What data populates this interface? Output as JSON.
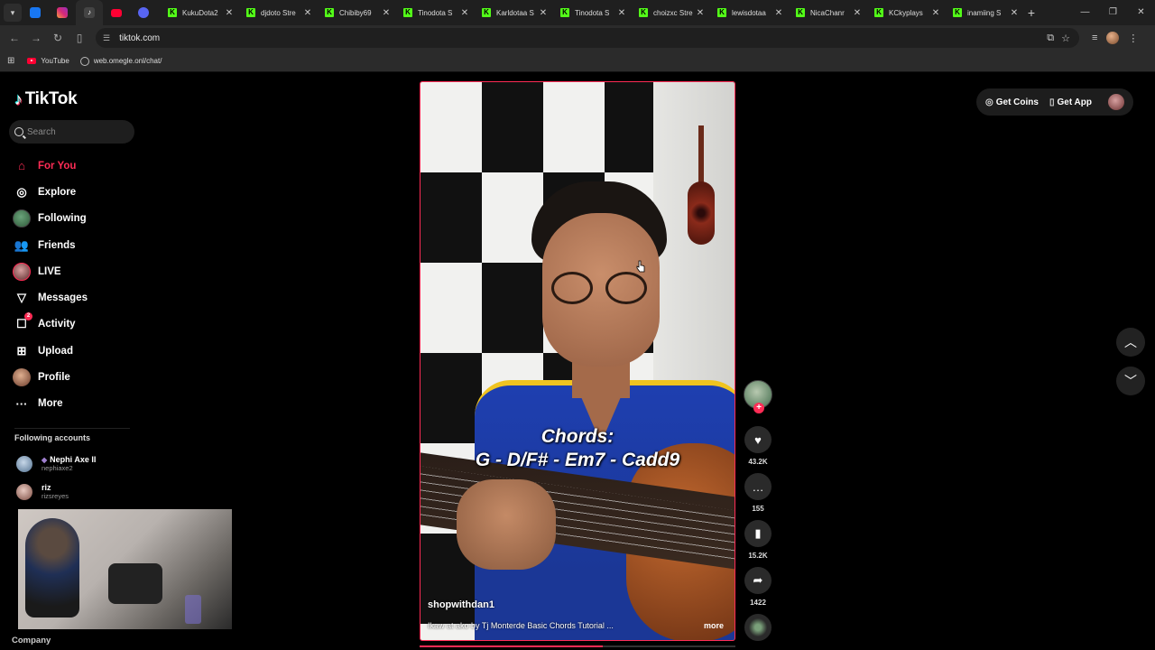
{
  "browser": {
    "tabs": [
      {
        "label": "KukuDota2"
      },
      {
        "label": "djdoto Stre"
      },
      {
        "label": "Chibiby69"
      },
      {
        "label": "Tinodota S"
      },
      {
        "label": "Karldotaa S"
      },
      {
        "label": "Tinodota S"
      },
      {
        "label": "choizxc Stre"
      },
      {
        "label": "lewisdotaa"
      },
      {
        "label": "NicaChanr"
      },
      {
        "label": "KCkyplays"
      },
      {
        "label": "inamiing S"
      }
    ],
    "new_tab": "+",
    "url": "tiktok.com",
    "bookmarks": [
      {
        "label": "YouTube",
        "icon": "youtube-icon"
      },
      {
        "label": "web.omegle.onl/chat/",
        "icon": "globe-icon"
      }
    ]
  },
  "tiktok": {
    "logo_text": "TikTok",
    "search_placeholder": "Search",
    "nav": [
      {
        "label": "For You",
        "icon": "home-icon",
        "active": true
      },
      {
        "label": "Explore",
        "icon": "compass-icon"
      },
      {
        "label": "Following",
        "icon": "avatar-icon"
      },
      {
        "label": "Friends",
        "icon": "friends-icon"
      },
      {
        "label": "LIVE",
        "icon": "live-icon"
      },
      {
        "label": "Messages",
        "icon": "send-icon"
      },
      {
        "label": "Activity",
        "icon": "inbox-icon",
        "badge": "2"
      },
      {
        "label": "Upload",
        "icon": "plus-square-icon"
      },
      {
        "label": "Profile",
        "icon": "profile-icon"
      },
      {
        "label": "More",
        "icon": "more-icon"
      }
    ],
    "following_heading": "Following accounts",
    "accounts": [
      {
        "name": "Nephi Axe II",
        "handle": "nephiaxe2"
      },
      {
        "name": "riz",
        "handle": "rizsreyes"
      }
    ],
    "footer_heading": "Company",
    "top_actions": {
      "coins": "Get Coins",
      "app": "Get App"
    },
    "video": {
      "overlay_line1": "Chords:",
      "overlay_line2": "G - D/F# - Em7 - Cadd9",
      "username": "shopwithdan1",
      "description": "Ikaw at ako by Tj Monterde Basic Chords Tutorial ...",
      "more": "more",
      "progress_fraction": 0.58
    },
    "actions": {
      "likes": "43.2K",
      "comments": "155",
      "saves": "15.2K",
      "shares": "1422"
    },
    "colors": {
      "accent": "#fe2c55",
      "background": "#000000"
    }
  }
}
